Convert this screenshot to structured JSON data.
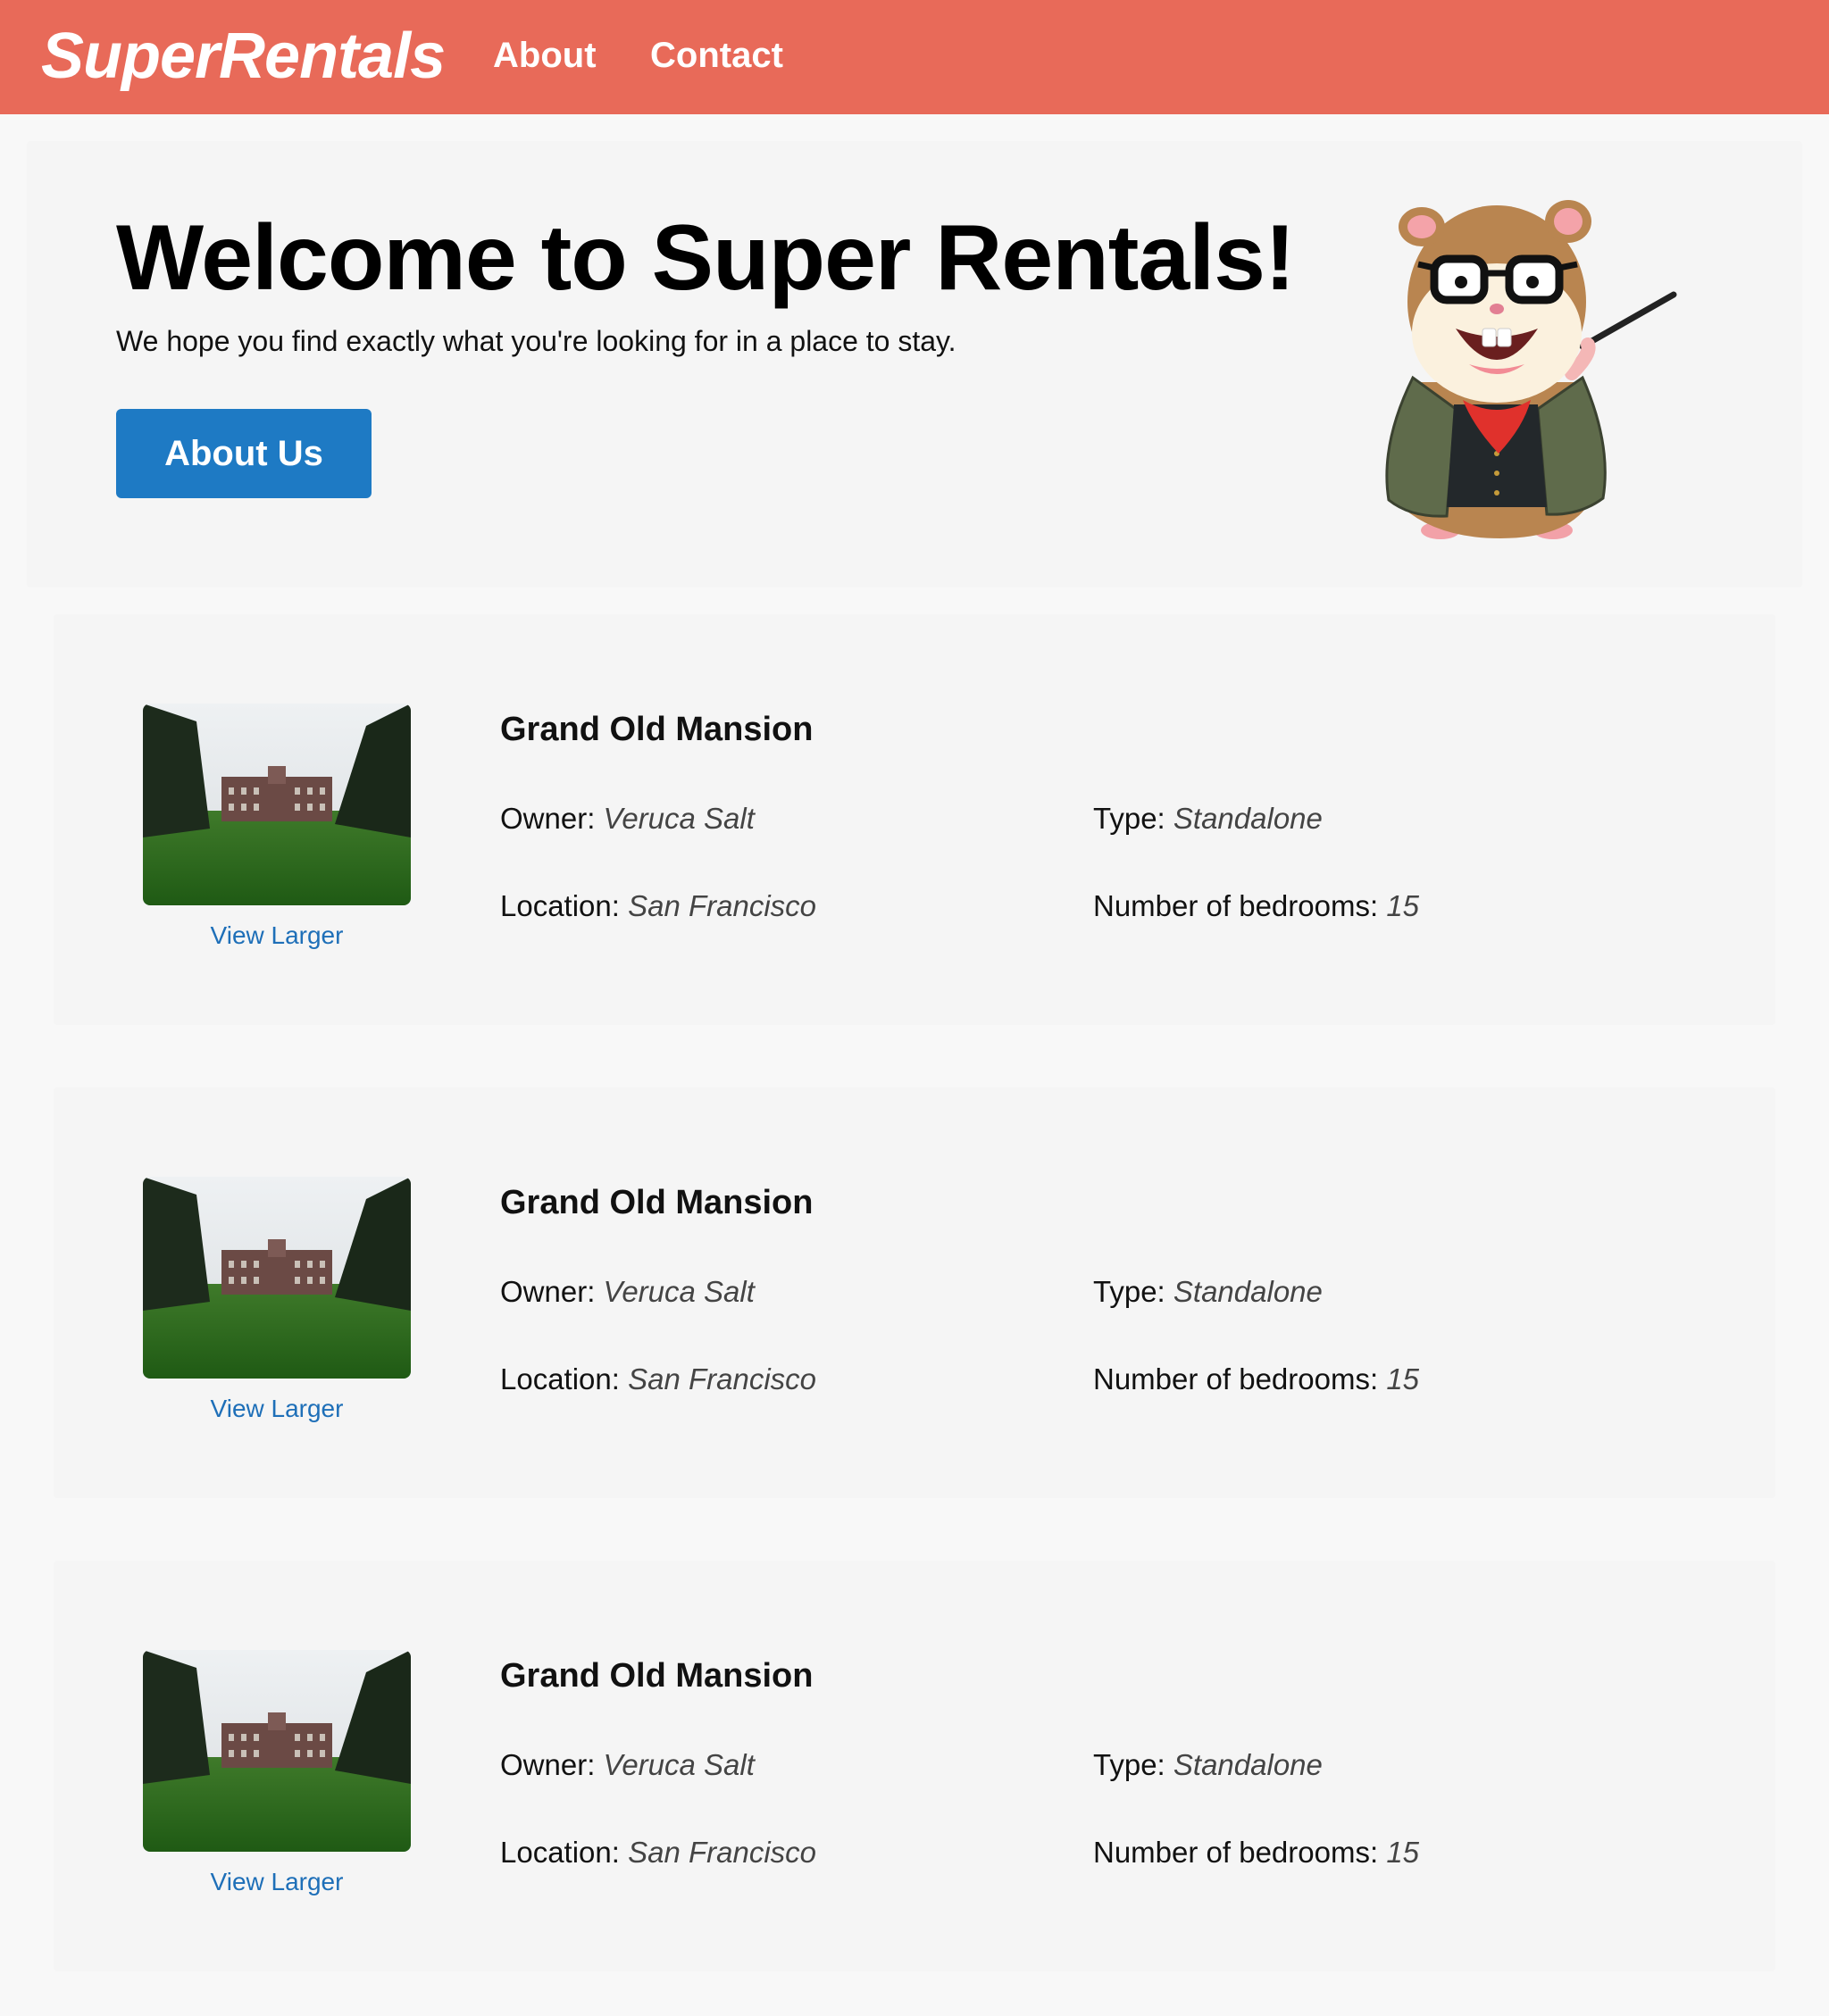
{
  "nav": {
    "brand": "SuperRentals",
    "links": [
      "About",
      "Contact"
    ],
    "background_color": "#e86a59"
  },
  "jumbo": {
    "title": "Welcome to Super Rentals!",
    "subtitle": "We hope you find exactly what you're looking for in a place to stay.",
    "button_label": "About Us",
    "button_color": "#1e7ac4",
    "mascot_icon": "tomster-mascot-with-pointer"
  },
  "rentals": [
    {
      "title": "Grand Old Mansion",
      "image_icon": "mansion-photo",
      "view_larger": "View Larger",
      "owner_label": "Owner:",
      "owner": "Veruca Salt",
      "type_label": "Type:",
      "type": "Standalone",
      "location_label": "Location:",
      "location": "San Francisco",
      "bedrooms_label": "Number of bedrooms:",
      "bedrooms": "15"
    },
    {
      "title": "Grand Old Mansion",
      "image_icon": "mansion-photo",
      "view_larger": "View Larger",
      "owner_label": "Owner:",
      "owner": "Veruca Salt",
      "type_label": "Type:",
      "type": "Standalone",
      "location_label": "Location:",
      "location": "San Francisco",
      "bedrooms_label": "Number of bedrooms:",
      "bedrooms": "15"
    },
    {
      "title": "Grand Old Mansion",
      "image_icon": "mansion-photo",
      "view_larger": "View Larger",
      "owner_label": "Owner:",
      "owner": "Veruca Salt",
      "type_label": "Type:",
      "type": "Standalone",
      "location_label": "Location:",
      "location": "San Francisco",
      "bedrooms_label": "Number of bedrooms:",
      "bedrooms": "15"
    }
  ]
}
